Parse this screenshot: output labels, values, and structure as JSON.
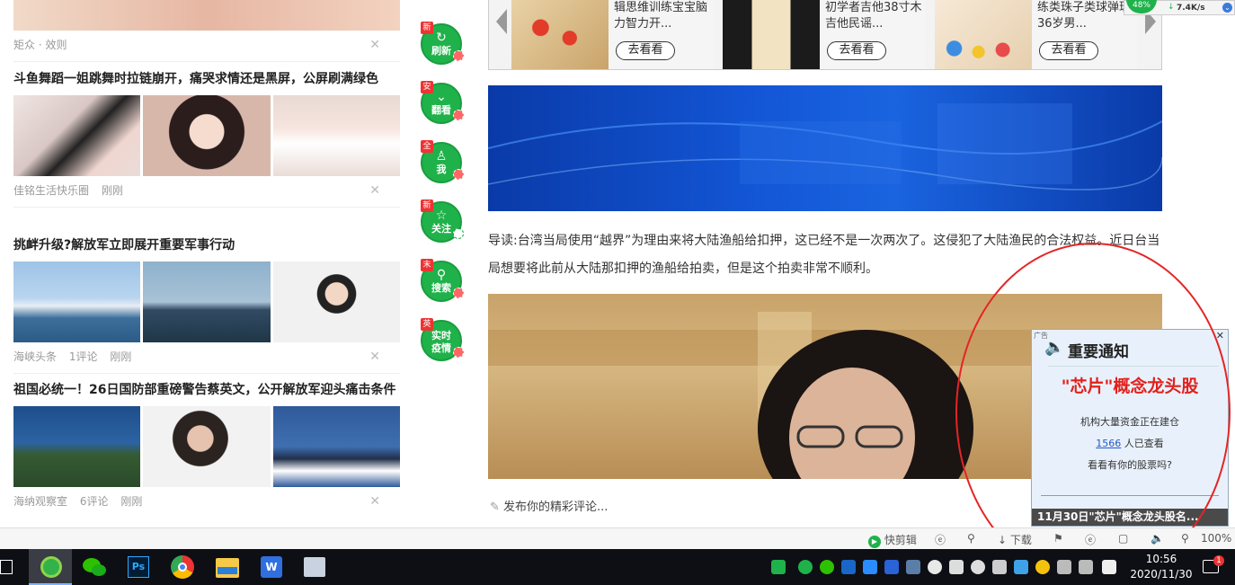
{
  "feed": [
    {
      "title": "",
      "source": "矩众 · 效则",
      "time": "",
      "comments": ""
    },
    {
      "title": "斗鱼舞蹈一姐跳舞时拉链崩开，痛哭求情还是黑屏，公屏刷满绿色",
      "source": "佳铭生活快乐圈",
      "time": "刚刚",
      "comments": ""
    },
    {
      "title": "挑衅升级?解放军立即展开重要军事行动",
      "source": "海峡头条",
      "time": "刚刚",
      "comments": "1评论"
    },
    {
      "title": "祖国必统一！26日国防部重磅警告蔡英文，公开解放军迎头痛击条件",
      "source": "海纳观察室",
      "time": "刚刚",
      "comments": "6评论"
    }
  ],
  "close_glyph": "✕",
  "side_buttons": [
    {
      "tag": "新",
      "label": "刷新",
      "icon": "refresh-icon",
      "glyph": "↻"
    },
    {
      "tag": "安",
      "label": "翻看",
      "icon": "chevron-down-icon",
      "glyph": "⌄"
    },
    {
      "tag": "全",
      "label": "我",
      "icon": "user-icon",
      "glyph": "♙"
    },
    {
      "tag": "新",
      "label": "关注",
      "icon": "bookmark-icon",
      "glyph": "☆"
    },
    {
      "tag": "末",
      "label": "搜索",
      "icon": "search-icon",
      "glyph": "⚲"
    },
    {
      "tag": "英",
      "label": "实时疫情",
      "icon": "",
      "glyph": ""
    }
  ],
  "products": [
    {
      "text": "辑思维训练宝宝脑力智力开...",
      "button": "去看看"
    },
    {
      "text": "初学者吉他38寸木吉他民谣...",
      "button": "去看看"
    },
    {
      "text": "练类珠子类球弹珠36岁男...",
      "button": "去看看"
    }
  ],
  "lead": "导读:台湾当局使用“越界”为理由来将大陆渔船给扣押，这已经不是一次两次了。这侵犯了大陆渔民的合法权益。近日台当局想要将此前从大陆那扣押的渔船给拍卖，但是这个拍卖非常不顺利。",
  "comment_placeholder": "发布你的精彩评论...",
  "ad": {
    "label": "广告",
    "title": "重要通知",
    "headline": "\"芯片\"概念龙头股",
    "line1": "机构大量资金正在建仓",
    "count": "1566",
    "line2_suffix": "人已查看",
    "line3": "看看有你的股票吗?",
    "bottom": "11月30日\"芯片\"概念龙头股名..."
  },
  "statusbar": {
    "kuaijianji": "快剪辑",
    "download": "下载",
    "zoom": "100%"
  },
  "netspeed": {
    "value": "7.4K/s",
    "percent": "48%"
  },
  "clock": {
    "time": "10:56",
    "date": "2020/11/30"
  },
  "notification_count": "1",
  "colors": {
    "green": "#1fb24a",
    "red": "#e52525",
    "blue": "#1356d6"
  }
}
